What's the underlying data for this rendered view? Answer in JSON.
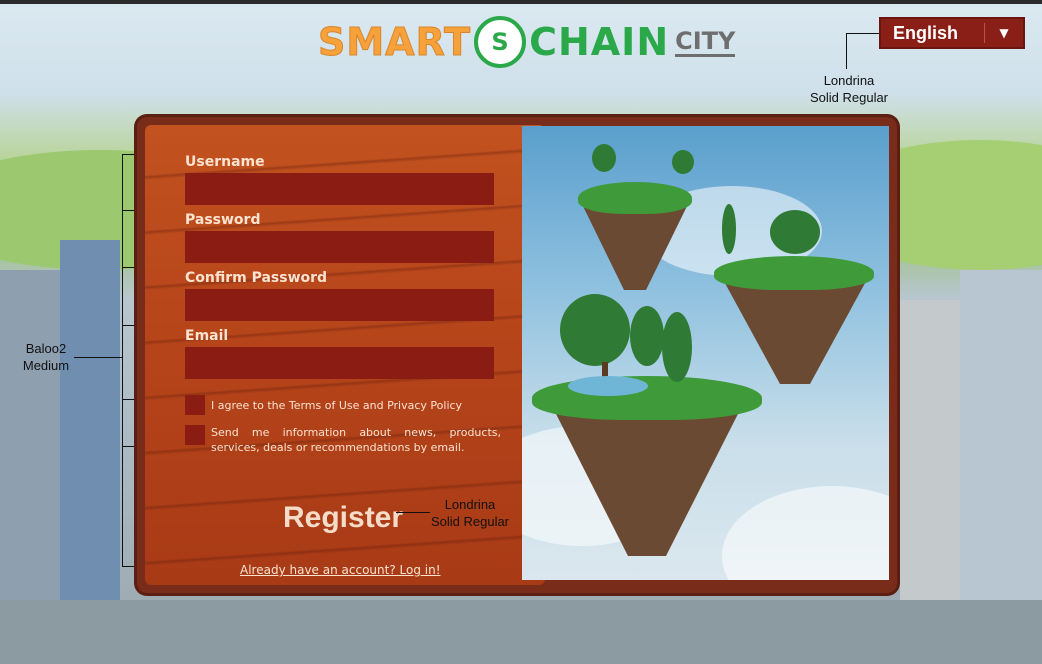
{
  "logo": {
    "smart": "SMART",
    "coin": "S",
    "chain": "CHAIN",
    "city": "CITY"
  },
  "language": {
    "selected": "English"
  },
  "annotations": {
    "lang_font": [
      "Londrina",
      "Solid Regular"
    ],
    "form_font": [
      "Baloo2",
      "Medium"
    ],
    "register_font": [
      "Londrina",
      "Solid Regular"
    ]
  },
  "form": {
    "username_label": "Username",
    "password_label": "Password",
    "confirm_label": "Confirm Password",
    "email_label": "Email",
    "terms_text": "I agree to the Terms of Use and Privacy Policy",
    "news_text": "Send me information about news, products, services, deals or recommendations by email.",
    "register_label": "Register",
    "login_link": "Already have an account? Log in!"
  },
  "colors": {
    "input_bg": "#8a1c13",
    "wood": "#b8461b",
    "lang_bg": "#8a1f17"
  }
}
